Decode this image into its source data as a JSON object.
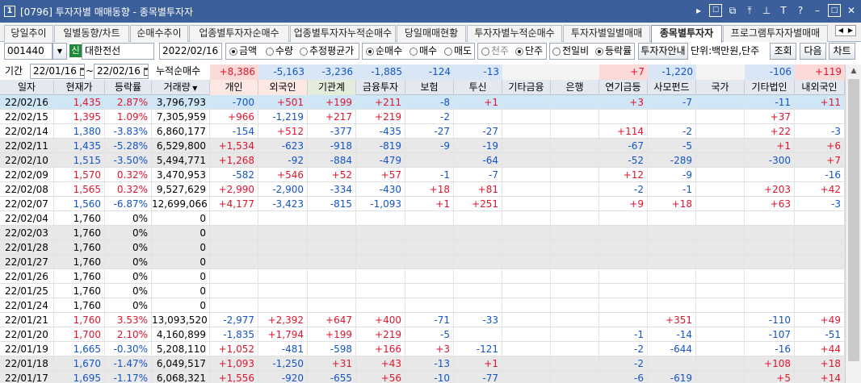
{
  "window": {
    "number": "1",
    "title": "[0796] 투자자별 매매동향 - 종목별투자자",
    "icons": [
      "chevron-right-icon",
      "link-icon",
      "window-icon",
      "pin-icon",
      "font-icon",
      "help-icon",
      "minimize-icon",
      "maximize-icon",
      "close-icon"
    ]
  },
  "tabs": [
    {
      "label": "당일추이",
      "active": false
    },
    {
      "label": "일별동향/차트",
      "active": false
    },
    {
      "label": "순매수추이",
      "active": false
    },
    {
      "label": "업종별투자자순매수",
      "active": false
    },
    {
      "label": "업종별투자자누적순매수",
      "active": false
    },
    {
      "label": "당일매매현황",
      "active": false
    },
    {
      "label": "투자자별누적순매수",
      "active": false
    },
    {
      "label": "투자자별일별매매",
      "active": false
    },
    {
      "label": "종목별투자자",
      "active": true
    },
    {
      "label": "프로그램투자자별매매",
      "active": false
    }
  ],
  "controls": {
    "code": "001440",
    "badge": "신",
    "stock_name": "대한전선",
    "date": "2022/02/16",
    "unit_group": [
      {
        "label": "금액",
        "on": true
      },
      {
        "label": "수량",
        "on": false
      },
      {
        "label": "추정평균가",
        "on": false
      }
    ],
    "side_group": [
      {
        "label": "순매수",
        "on": true
      },
      {
        "label": "매수",
        "on": false
      },
      {
        "label": "매도",
        "on": false
      }
    ],
    "unit2_group": [
      {
        "label": "천주",
        "on": false
      },
      {
        "label": "단주",
        "on": true
      }
    ],
    "ratio_group": [
      {
        "label": "전일비",
        "on": false
      },
      {
        "label": "등락률",
        "on": true
      }
    ],
    "guide_button": "투자자안내",
    "unit_text": "단위:백만원,단주",
    "search_button": "조회",
    "next_button": "다음",
    "chart_button": "차트",
    "period_label": "기간",
    "period_from": "22/01/16",
    "period_to": "22/02/16",
    "cum_label": "누적순매수"
  },
  "summary": [
    "+8,386",
    "-5,163",
    "-3,236",
    "-1,885",
    "-124",
    "-13",
    "",
    "",
    "+7",
    "-1,220",
    "",
    "-106",
    "+119"
  ],
  "colors": {
    "up": "#e0142d",
    "down": "#1454c8",
    "selected_row": "#cfe6f7",
    "shaded_row": "#e8e8e8",
    "summary_pos_bg": "#fbd9d6",
    "summary_neg_bg": "#d9e6f5",
    "title_bar": "#3b5f9a"
  },
  "columns": [
    "일자",
    "현재가",
    "등락률",
    "거래량",
    "개인",
    "외국인",
    "기관계",
    "금융투자",
    "보험",
    "투신",
    "기타금융",
    "은행",
    "연기금등",
    "사모펀드",
    "국가",
    "기타법인",
    "내외국인"
  ],
  "rows": [
    [
      "22/02/16",
      "1,435",
      "2.87%",
      "3,796,793",
      "-700",
      "+501",
      "+199",
      "+211",
      "-8",
      "+1",
      "",
      "",
      "+3",
      "-7",
      "",
      "-11",
      "+11"
    ],
    [
      "22/02/15",
      "1,395",
      "1.09%",
      "7,305,959",
      "+966",
      "-1,219",
      "+217",
      "+219",
      "-2",
      "",
      "",
      "",
      "",
      "",
      "",
      "+37",
      ""
    ],
    [
      "22/02/14",
      "1,380",
      "-3.83%",
      "6,860,177",
      "-154",
      "+512",
      "-377",
      "-435",
      "-27",
      "-27",
      "",
      "",
      "+114",
      "-2",
      "",
      "+22",
      "-3"
    ],
    [
      "22/02/11",
      "1,435",
      "-5.28%",
      "6,529,800",
      "+1,534",
      "-623",
      "-918",
      "-819",
      "-9",
      "-19",
      "",
      "",
      "-67",
      "-5",
      "",
      "+1",
      "+6"
    ],
    [
      "22/02/10",
      "1,515",
      "-3.50%",
      "5,494,771",
      "+1,268",
      "-92",
      "-884",
      "-479",
      "",
      "-64",
      "",
      "",
      "-52",
      "-289",
      "",
      "-300",
      "+7"
    ],
    [
      "22/02/09",
      "1,570",
      "0.32%",
      "3,470,953",
      "-582",
      "+546",
      "+52",
      "+57",
      "-1",
      "-7",
      "",
      "",
      "+12",
      "-9",
      "",
      "",
      "-16"
    ],
    [
      "22/02/08",
      "1,565",
      "0.32%",
      "9,527,629",
      "+2,990",
      "-2,900",
      "-334",
      "-430",
      "+18",
      "+81",
      "",
      "",
      "-2",
      "-1",
      "",
      "+203",
      "+42"
    ],
    [
      "22/02/07",
      "1,560",
      "-6.87%",
      "12,699,066",
      "+4,177",
      "-3,423",
      "-815",
      "-1,093",
      "+1",
      "+251",
      "",
      "",
      "+9",
      "+18",
      "",
      "+63",
      "-3"
    ],
    [
      "22/02/04",
      "1,760",
      "0%",
      "0",
      "",
      "",
      "",
      "",
      "",
      "",
      "",
      "",
      "",
      "",
      "",
      "",
      ""
    ],
    [
      "22/02/03",
      "1,760",
      "0%",
      "0",
      "",
      "",
      "",
      "",
      "",
      "",
      "",
      "",
      "",
      "",
      "",
      "",
      ""
    ],
    [
      "22/01/28",
      "1,760",
      "0%",
      "0",
      "",
      "",
      "",
      "",
      "",
      "",
      "",
      "",
      "",
      "",
      "",
      "",
      ""
    ],
    [
      "22/01/27",
      "1,760",
      "0%",
      "0",
      "",
      "",
      "",
      "",
      "",
      "",
      "",
      "",
      "",
      "",
      "",
      "",
      ""
    ],
    [
      "22/01/26",
      "1,760",
      "0%",
      "0",
      "",
      "",
      "",
      "",
      "",
      "",
      "",
      "",
      "",
      "",
      "",
      "",
      ""
    ],
    [
      "22/01/25",
      "1,760",
      "0%",
      "0",
      "",
      "",
      "",
      "",
      "",
      "",
      "",
      "",
      "",
      "",
      "",
      "",
      ""
    ],
    [
      "22/01/24",
      "1,760",
      "0%",
      "0",
      "",
      "",
      "",
      "",
      "",
      "",
      "",
      "",
      "",
      "",
      "",
      "",
      ""
    ],
    [
      "22/01/21",
      "1,760",
      "3.53%",
      "13,093,520",
      "-2,977",
      "+2,392",
      "+647",
      "+400",
      "-71",
      "-33",
      "",
      "",
      "",
      "+351",
      "",
      "-110",
      "+49"
    ],
    [
      "22/01/20",
      "1,700",
      "2.10%",
      "4,160,899",
      "-1,835",
      "+1,794",
      "+199",
      "+219",
      "-5",
      "",
      "",
      "",
      "-1",
      "-14",
      "",
      "-107",
      "-51"
    ],
    [
      "22/01/19",
      "1,665",
      "-0.30%",
      "5,208,110",
      "+1,052",
      "-481",
      "-598",
      "+166",
      "+3",
      "-121",
      "",
      "",
      "-2",
      "-644",
      "",
      "-16",
      "+44"
    ],
    [
      "22/01/18",
      "1,670",
      "-1.47%",
      "6,049,517",
      "+1,093",
      "-1,250",
      "+31",
      "+43",
      "-13",
      "+1",
      "",
      "",
      "-2",
      "",
      "",
      "+108",
      "+18"
    ],
    [
      "22/01/17",
      "1,695",
      "-1.17%",
      "6,068,321",
      "+1,556",
      "-920",
      "-655",
      "+56",
      "-10",
      "-77",
      "",
      "",
      "-6",
      "-619",
      "",
      "+5",
      "+14"
    ]
  ],
  "selected_row": 0
}
